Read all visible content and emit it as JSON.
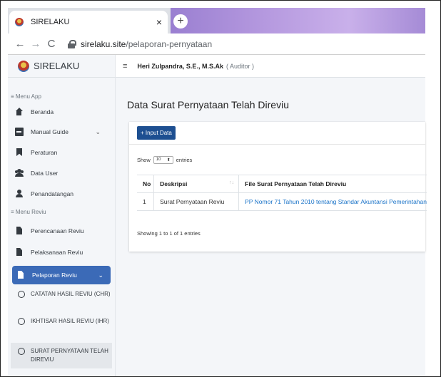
{
  "browser": {
    "tab_title": "SIRELAKU",
    "tab_close": "×",
    "new_tab": "+",
    "back": "←",
    "forward": "→",
    "reload": "C",
    "url_host": "sirelaku.site",
    "url_path": "/pelaporan-pernyataan"
  },
  "brand": {
    "name": "SIRELAKU"
  },
  "topnav": {
    "menu_icon": "≡",
    "user": "Heri Zulpandra, S.E., M.S.Ak",
    "role": "( Auditor )"
  },
  "sidebar": {
    "section_app": "≡ Menu App",
    "beranda": "Beranda",
    "manual_guide": "Manual Guide",
    "peraturan": "Peraturan",
    "data_user": "Data User",
    "penandatangan": "Penandatangan",
    "section_reviu": "≡ Menu Reviu",
    "perencanaan": "Perencanaan Reviu",
    "pelaksanaan": "Pelaksanaan Reviu",
    "pelaporan": "Pelaporan Reviu",
    "chevron": "⌄",
    "sub_chr": "CATATAN HASIL REVIU (CHR)",
    "sub_ihr": "IKHTISAR HASIL REVIU (IHR)",
    "sub_surat": "SURAT PERNYATAAN TELAH DIREVIU"
  },
  "main": {
    "title": "Data Surat Pernyataan Telah Direviu",
    "input_button": "+ Input Data",
    "show_label": "Show",
    "show_value": "10",
    "entries_label": "entries",
    "columns": [
      "No",
      "Deskripsi",
      "File Surat Pernyataan Telah Direviu"
    ],
    "sort_icon": "↑↓",
    "rows": [
      {
        "no": "1",
        "deskripsi": "Surat Pernyataan Reviu",
        "file": "PP Nomor 71 Tahun 2010 tentang Standar Akuntansi Pemerintahan"
      }
    ],
    "info": "Showing 1 to 1 of 1 entries"
  },
  "colors": {
    "sidebar_active": "#3b6ab7",
    "button": "#1d4f91",
    "link": "#1a73c8"
  }
}
